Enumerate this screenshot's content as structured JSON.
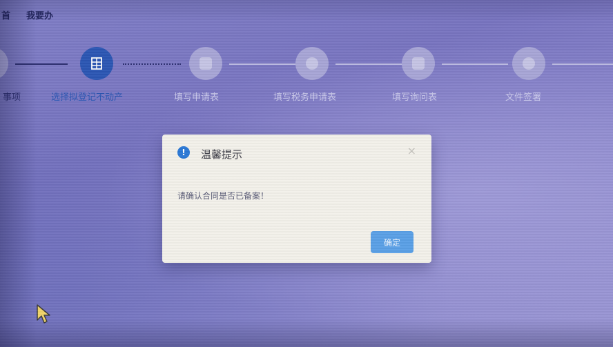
{
  "topbar": {
    "tab_prev": "首",
    "tab_mine": "我要办"
  },
  "stepper": {
    "steps": [
      {
        "label": "事项",
        "state": "done"
      },
      {
        "label": "选择拟登记不动产",
        "state": "active",
        "icon": "building-icon"
      },
      {
        "label": "填写申请表",
        "state": "pending",
        "icon": "form-icon"
      },
      {
        "label": "填写税务申请表",
        "state": "pending",
        "icon": "tax-icon"
      },
      {
        "label": "填写询问表",
        "state": "pending",
        "icon": "question-icon"
      },
      {
        "label": "文件签署",
        "state": "pending",
        "icon": "sign-icon"
      }
    ]
  },
  "modal": {
    "title": "温馨提示",
    "message": "请确认合同是否已备案！",
    "close": "×",
    "ok_label": "确定",
    "info_icon": "!"
  },
  "colors": {
    "accent": "#2b56b3",
    "button": "#5aa0e6",
    "dialog_bg": "#f3f1ea"
  }
}
